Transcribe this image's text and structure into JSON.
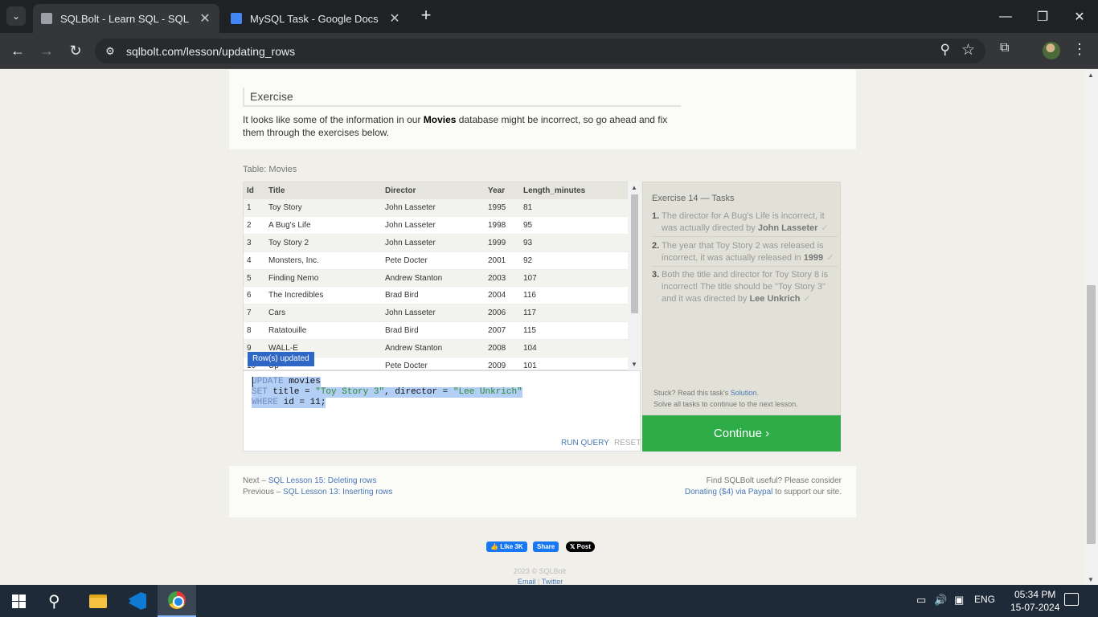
{
  "browser": {
    "tabs": [
      {
        "title": "SQLBolt - Learn SQL - SQL Less",
        "active": true
      },
      {
        "title": "MySQL Task - Google Docs",
        "active": false
      }
    ],
    "url": "sqlbolt.com/lesson/updating_rows"
  },
  "lesson": {
    "exercise_heading": "Exercise",
    "intro_before": "It looks like some of the information in our ",
    "intro_bold": "Movies",
    "intro_after": " database might be incorrect, so go ahead and fix them through the exercises below.",
    "table_label": "Table: Movies",
    "columns": [
      "Id",
      "Title",
      "Director",
      "Year",
      "Length_minutes"
    ],
    "rows": [
      [
        "1",
        "Toy Story",
        "John Lasseter",
        "1995",
        "81"
      ],
      [
        "2",
        "A Bug's Life",
        "John Lasseter",
        "1998",
        "95"
      ],
      [
        "3",
        "Toy Story 2",
        "John Lasseter",
        "1999",
        "93"
      ],
      [
        "4",
        "Monsters, Inc.",
        "Pete Docter",
        "2001",
        "92"
      ],
      [
        "5",
        "Finding Nemo",
        "Andrew Stanton",
        "2003",
        "107"
      ],
      [
        "6",
        "The Incredibles",
        "Brad Bird",
        "2004",
        "116"
      ],
      [
        "7",
        "Cars",
        "John Lasseter",
        "2006",
        "117"
      ],
      [
        "8",
        "Ratatouille",
        "Brad Bird",
        "2007",
        "115"
      ],
      [
        "9",
        "WALL-E",
        "Andrew Stanton",
        "2008",
        "104"
      ],
      [
        "10",
        "Up",
        "Pete Docter",
        "2009",
        "101"
      ]
    ],
    "toast": "Row(s) updated",
    "query": {
      "l1_kw": "UPDATE",
      "l1_rest": " movies",
      "l2_kw": "SET",
      "l2_a": " title = ",
      "l2_s1": "\"Toy Story 3\"",
      "l2_b": ", director = ",
      "l2_s2": "\"Lee Unkrich\"",
      "l3_kw": "WHERE",
      "l3_rest": " id = 11;"
    },
    "run_label": "RUN QUERY",
    "reset_label": "RESET",
    "tasks": {
      "title": "Exercise 14 — Tasks",
      "t1_num": "1.",
      "t1_text": "The director for A Bug's Life is incorrect, it was actually directed by ",
      "t1_bold": "John Lasseter",
      "t2_num": "2.",
      "t2_text": "The year that Toy Story 2 was released is incorrect, it was actually released in ",
      "t2_bold": "1999",
      "t3_num": "3.",
      "t3_text": "Both the title and director for Toy Story 8 is incorrect! The title should be \"Toy Story 3\" and it was directed by ",
      "t3_bold": "Lee Unkrich",
      "check": "✓",
      "stuck_text": "Stuck? Read this task's ",
      "solution_link": "Solution",
      "solve_all": "Solve all tasks to continue to the next lesson."
    },
    "continue_label": "Continue ›",
    "next_prefix": "Next – ",
    "next_link": "SQL Lesson 15: Deleting rows",
    "prev_prefix": "Previous – ",
    "prev_link": "SQL Lesson 13: Inserting rows",
    "donate_line1": "Find SQLBolt useful? Please consider",
    "donate_link": "Donating ($4) via Paypal",
    "donate_suffix": " to support our site."
  },
  "social": {
    "like": "Like 3K",
    "share": "Share",
    "post": "Post"
  },
  "footer": {
    "copyright": "2023 © SQLBolt",
    "email": "Email",
    "twitter": "Twitter"
  },
  "taskbar": {
    "lang": "ENG",
    "time": "05:34 PM",
    "date": "15-07-2024"
  },
  "colors": {
    "continue": "#2eac47",
    "toast": "#2f67c6",
    "selection": "#b4cff5"
  }
}
